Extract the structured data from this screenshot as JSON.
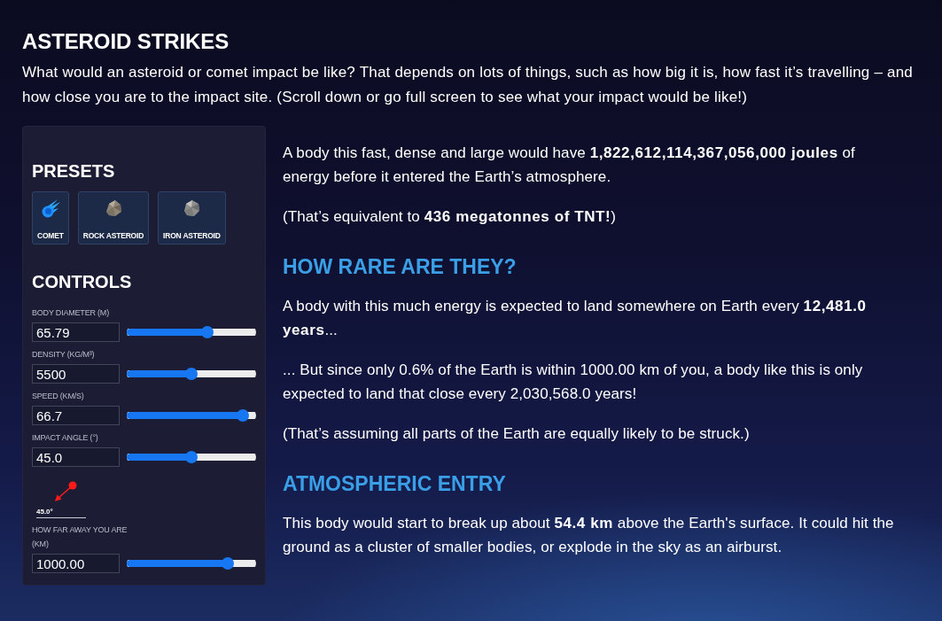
{
  "header": {
    "title": "ASTEROID STRIKES",
    "intro": "What would an asteroid or comet impact be like? That depends on lots of things, such as how big it is, how fast it’s travelling – and how close you are to the impact site. (Scroll down or go full screen to see what your impact would be like!)"
  },
  "panel": {
    "presets_heading": "PRESETS",
    "presets": [
      {
        "kind": "comet",
        "label": "COMET"
      },
      {
        "kind": "rock",
        "label": "ROCK ASTEROID"
      },
      {
        "kind": "iron",
        "label": "IRON ASTEROID"
      }
    ],
    "controls_heading": "CONTROLS",
    "controls": [
      {
        "kind": "slider",
        "label": "BODY DIAMETER (M)",
        "value": "65.79",
        "level": 0.64
      },
      {
        "kind": "slider",
        "label": "DENSITY (KG/M³)",
        "value": "5500",
        "level": 0.5
      },
      {
        "kind": "slider",
        "label": "SPEED (KM/S)",
        "value": "66.7",
        "level": 0.94
      },
      {
        "kind": "slider",
        "label": "IMPACT ANGLE (°)",
        "value": "45.0",
        "level": 0.5
      },
      {
        "kind": "angle_marker",
        "reading": "45.0°"
      },
      {
        "kind": "slider",
        "label": "HOW FAR AWAY YOU ARE (KM)",
        "value": "1000.00",
        "level": 0.81
      }
    ]
  },
  "results": [
    {
      "kind": "paragraph",
      "text": "A body this fast, dense and large would have **1,822,612,114,367,056,000 joules** of energy before it entered the Earth’s atmosphere."
    },
    {
      "kind": "paragraph",
      "text": "(That’s equivalent to **436 megatonnes of TNT!**)"
    },
    {
      "kind": "heading",
      "text": "HOW RARE ARE THEY?"
    },
    {
      "kind": "paragraph",
      "text": "A body with this much energy is expected to land somewhere on Earth every **12,481.0 years**..."
    },
    {
      "kind": "paragraph",
      "text": "... But since only 0.6% of the Earth is within 1000.00 km of you, a body like this is only expected to land that close every 2,030,568.0 years!"
    },
    {
      "kind": "paragraph",
      "text": "(That’s assuming all parts of the Earth are equally likely to be struck.)"
    },
    {
      "kind": "heading",
      "text": "ATMOSPHERIC ENTRY"
    },
    {
      "kind": "paragraph",
      "text": "This body would start to break up about **54.4 km** above the Earth's surface. It could hit the ground as a cluster of smaller bodies, or explode in the sky as an airburst."
    }
  ]
}
